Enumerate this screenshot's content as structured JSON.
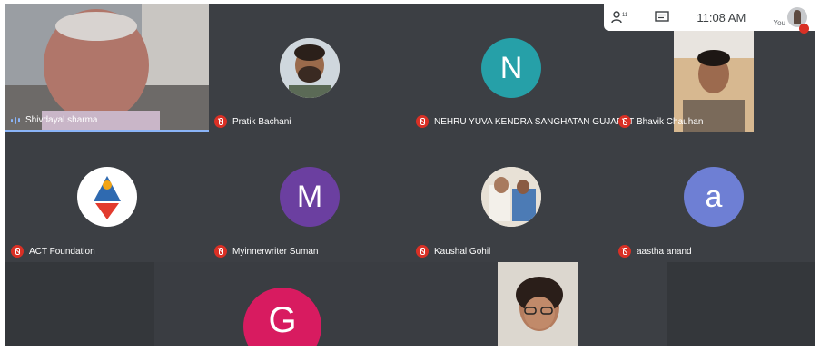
{
  "toolbar": {
    "people_icon": "people-icon",
    "chat_icon": "chat-icon",
    "clock": "11:08 AM",
    "self_label": "You"
  },
  "participants": [
    {
      "name": "Shivdayal sharma",
      "type": "video",
      "speaking": true
    },
    {
      "name": "Pratik Bachani",
      "type": "photo",
      "muted": true
    },
    {
      "name": "NEHRU YUVA KENDRA SANGHATAN GUJARAT",
      "type": "initial",
      "initial": "N",
      "color": "#26a0a8",
      "muted": true
    },
    {
      "name": "Bhavik Chauhan",
      "type": "video",
      "muted": true
    },
    {
      "name": "ACT Foundation",
      "type": "logo",
      "muted": true
    },
    {
      "name": "Myinnerwriter Suman",
      "type": "initial",
      "initial": "M",
      "color": "#6b3fa0",
      "muted": true
    },
    {
      "name": "Kaushal Gohil",
      "type": "photo",
      "muted": true
    },
    {
      "name": "aastha anand",
      "type": "initial",
      "initial": "a",
      "color": "#6e7fd4",
      "muted": true
    },
    {
      "name": "",
      "type": "initial",
      "initial": "G",
      "color": "#d81b60"
    }
  ],
  "colors": {
    "background": "#3c3f44",
    "mute": "#d93025",
    "speaking": "#8ab4f8"
  }
}
